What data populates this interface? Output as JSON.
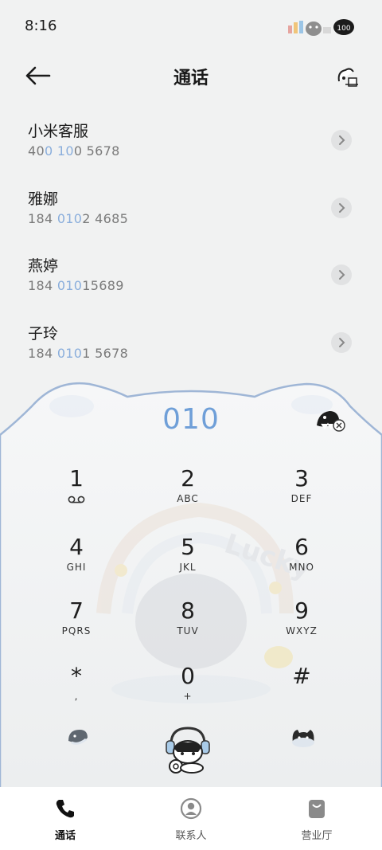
{
  "status": {
    "time": "8:16"
  },
  "header": {
    "title": "通话"
  },
  "contacts": [
    {
      "name": "小米客服",
      "num_pre": "40",
      "num_hl1": "0",
      "num_mid": " ",
      "num_hl2": "10",
      "num_post": "0 5678"
    },
    {
      "name": "雅娜",
      "num_pre": "184 ",
      "num_hl1": "010",
      "num_mid": "",
      "num_hl2": "",
      "num_post": "2 4685"
    },
    {
      "name": "燕婷",
      "num_pre": "184 ",
      "num_hl1": "010",
      "num_mid": "",
      "num_hl2": "",
      "num_post": "15689"
    },
    {
      "name": "子玲",
      "num_pre": "184 ",
      "num_hl1": "010",
      "num_mid": "",
      "num_hl2": "",
      "num_post": "1 5678"
    }
  ],
  "dialer": {
    "input": "010",
    "keys": [
      {
        "digit": "1",
        "letters": ""
      },
      {
        "digit": "2",
        "letters": "ABC"
      },
      {
        "digit": "3",
        "letters": "DEF"
      },
      {
        "digit": "4",
        "letters": "GHI"
      },
      {
        "digit": "5",
        "letters": "JKL"
      },
      {
        "digit": "6",
        "letters": "MNO"
      },
      {
        "digit": "7",
        "letters": "PQRS"
      },
      {
        "digit": "8",
        "letters": "TUV"
      },
      {
        "digit": "9",
        "letters": "WXYZ"
      },
      {
        "digit": "*",
        "letters": ","
      },
      {
        "digit": "0",
        "letters": "+"
      },
      {
        "digit": "#",
        "letters": ""
      }
    ],
    "watermark": "Lucky"
  },
  "tabs": [
    {
      "label": "通话",
      "icon": "phone-icon",
      "active": true
    },
    {
      "label": "联系人",
      "icon": "person-icon",
      "active": false
    },
    {
      "label": "营业厅",
      "icon": "bag-icon",
      "active": false
    }
  ],
  "colors": {
    "accent": "#6f9fd8",
    "highlight": "#8aaedc",
    "outline": "#9fb6d6"
  }
}
